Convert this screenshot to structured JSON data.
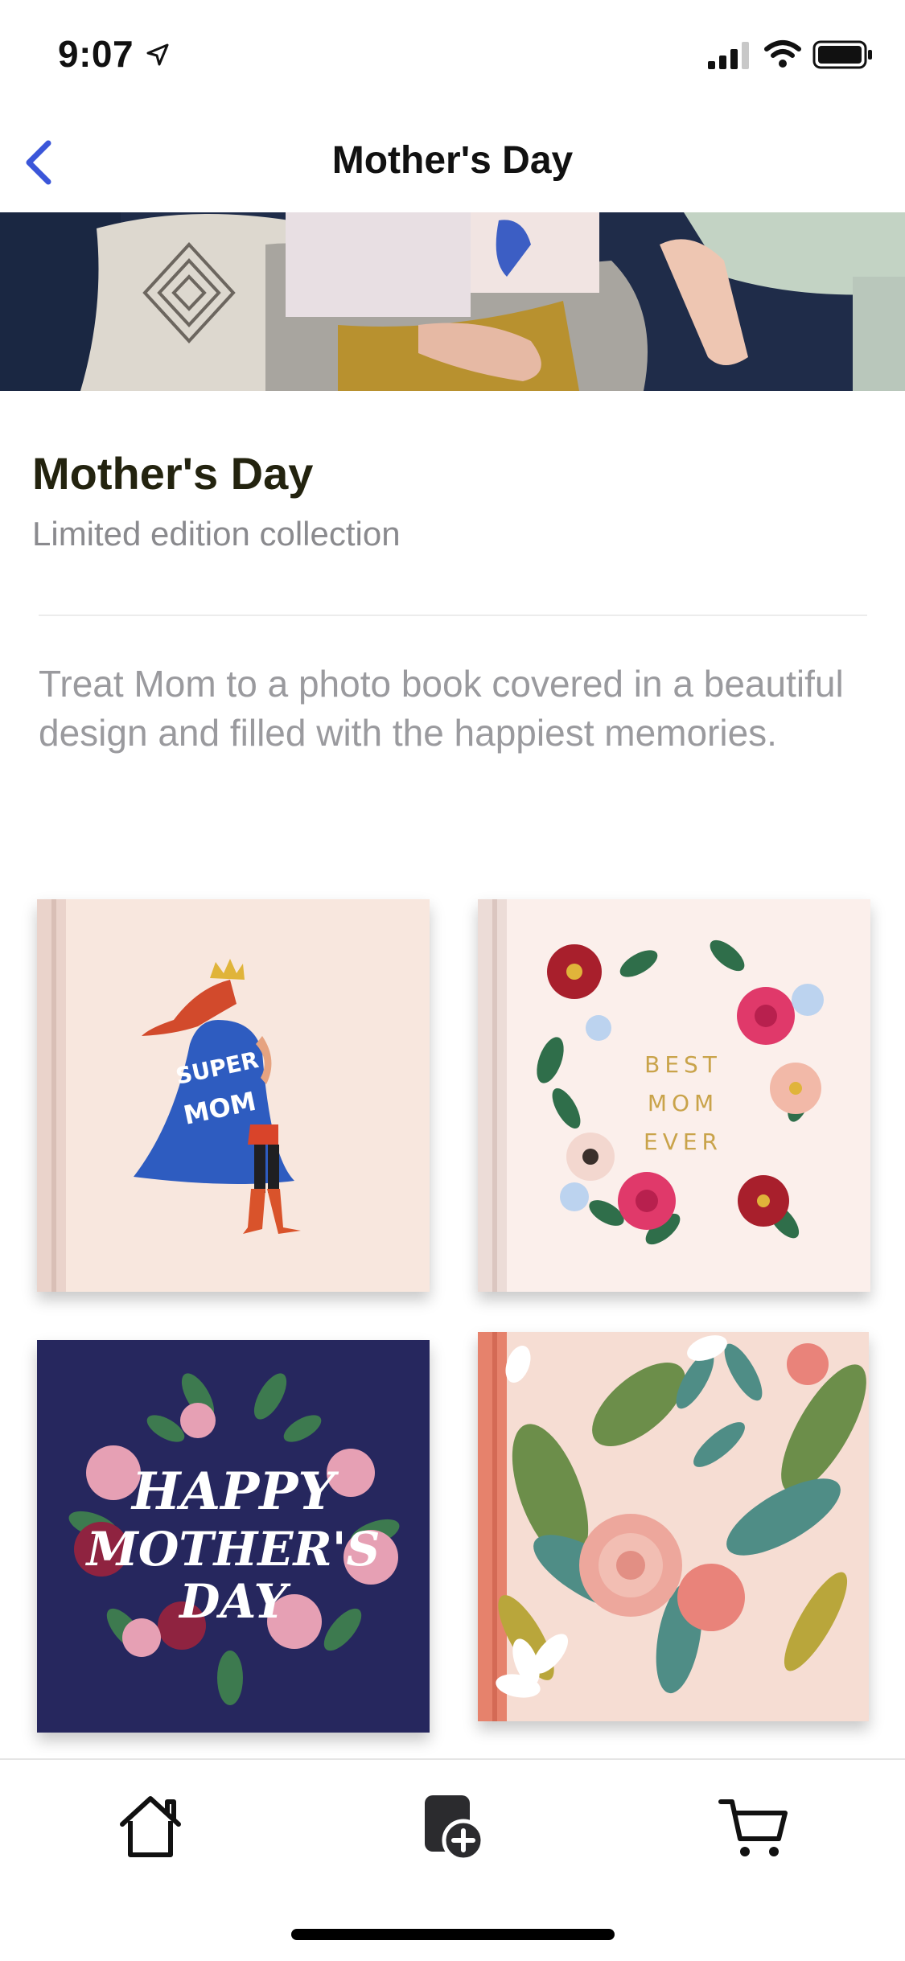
{
  "status_bar": {
    "time": "9:07"
  },
  "nav": {
    "title": "Mother's Day"
  },
  "collection": {
    "title": "Mother's Day",
    "subtitle": "Limited edition collection",
    "description": "Treat Mom to a photo book covered in a beautiful design and filled with the happiest memories."
  },
  "books": [
    {
      "cover_text": "SUPER MOM"
    },
    {
      "cover_text_lines": [
        "BEST",
        "MOM",
        "EVER"
      ]
    },
    {
      "cover_text_lines": [
        "HAPPY",
        "MOTHER'S",
        "DAY"
      ]
    },
    {
      "cover_text": ""
    }
  ],
  "tabs": [
    "home-icon",
    "create-book-icon",
    "cart-icon"
  ],
  "colors": {
    "accent": "#3b56d9",
    "title_dark": "#23230f",
    "muted": "#8a8a8e"
  }
}
